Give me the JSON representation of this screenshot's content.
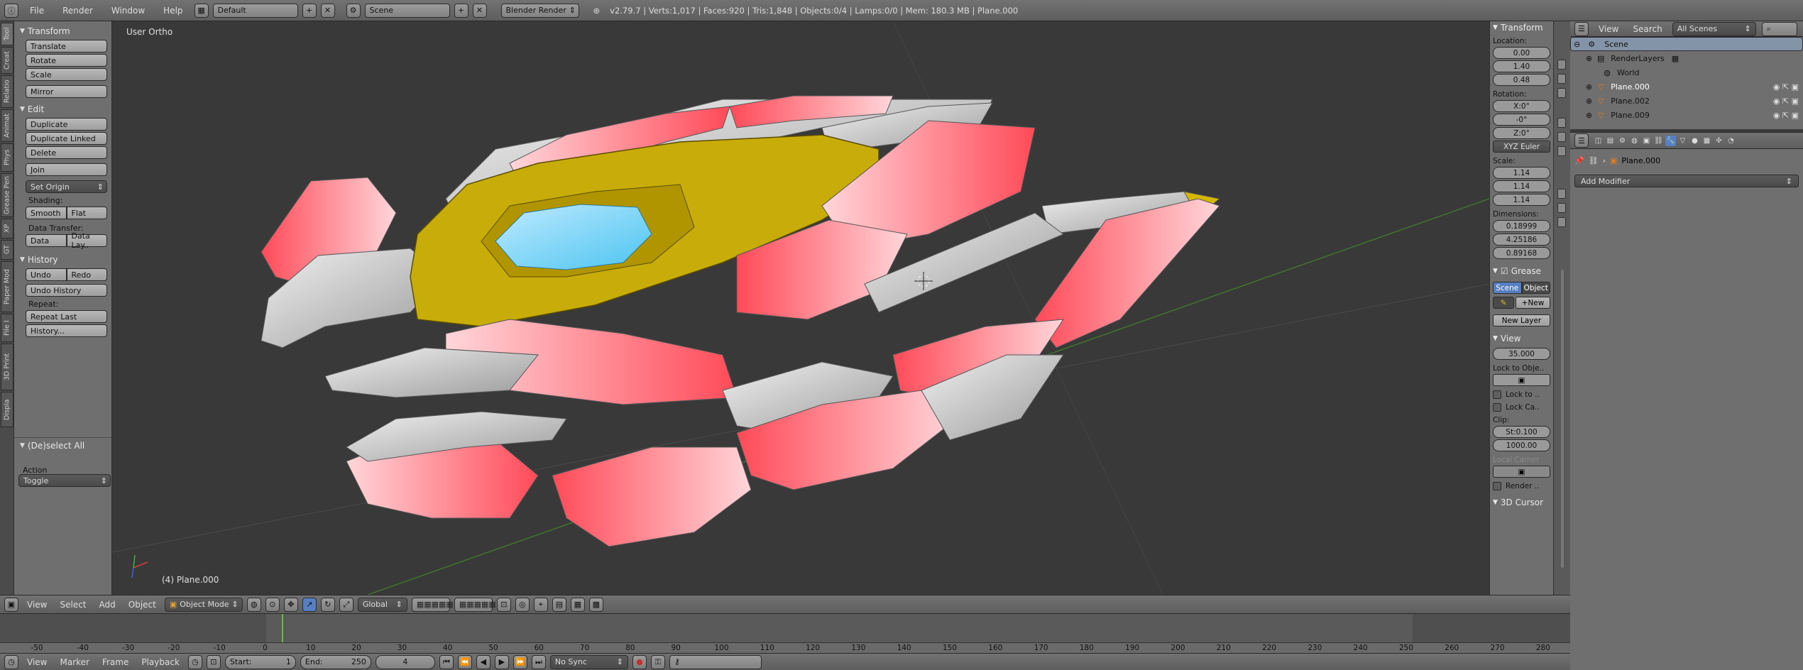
{
  "topbar": {
    "menus": [
      "File",
      "Render",
      "Window",
      "Help"
    ],
    "layout": "Default",
    "scene": "Scene",
    "engine": "Blender Render",
    "stats": "v2.79.7 | Verts:1,017 | Faces:920 | Tris:1,848 | Objects:0/4 | Lamps:0/0 | Mem: 180.3 MB | Plane.000"
  },
  "tool_tabs": [
    "Tool",
    "Creat",
    "Relatio",
    "Animat",
    "Phys",
    "Grease Pen",
    "XP",
    "GT",
    "Paper Mod",
    "File I",
    "3D Print",
    "Displa"
  ],
  "shelf": {
    "transform_title": "Transform",
    "translate": "Translate",
    "rotate": "Rotate",
    "scale": "Scale",
    "mirror": "Mirror",
    "edit_title": "Edit",
    "duplicate": "Duplicate",
    "duplicate_linked": "Duplicate Linked",
    "delete": "Delete",
    "join": "Join",
    "set_origin": "Set Origin",
    "shading_label": "Shading:",
    "smooth": "Smooth",
    "flat": "Flat",
    "data_transfer_label": "Data Transfer:",
    "data": "Data",
    "data_lay": "Data Lay..",
    "history_title": "History",
    "undo": "Undo",
    "redo": "Redo",
    "undo_history": "Undo History",
    "repeat_label": "Repeat:",
    "repeat_last": "Repeat Last",
    "history_more": "History...",
    "operator_title": "(De)select All",
    "action_label": "Action",
    "action_value": "Toggle"
  },
  "viewport": {
    "view_label": "User Ortho",
    "object_label": "(4) Plane.000"
  },
  "npanel": {
    "transform": "Transform",
    "location_label": "Location:",
    "location": [
      "0.00",
      "1.40",
      "0.48"
    ],
    "rotation_label": "Rotation:",
    "rotation": [
      "X:0°",
      "-0°",
      "Z:0°"
    ],
    "rotation_mode": "XYZ Euler",
    "scale_label": "Scale:",
    "scale": [
      "1.14",
      "1.14",
      "1.14"
    ],
    "dimensions_label": "Dimensions:",
    "dimensions": [
      "0.18999",
      "4.25186",
      "0.89168"
    ],
    "grease": "Grease",
    "scene_btn": "Scene",
    "object_btn": "Object",
    "new_btn": "New",
    "new_layer": "New Layer",
    "view": "View",
    "lens": "35.000",
    "lock_to_object": "Lock to Obje..",
    "lock_to": "Lock to ..",
    "lock_ca": "Lock Ca..",
    "clip_label": "Clip:",
    "clip_start": "St:0.100",
    "clip_end": "1000.00",
    "local_camera": "Local Camer",
    "render": "Render ..",
    "cursor": "3D Cursor"
  },
  "outliner": {
    "view": "View",
    "search": "Search",
    "scenes": "All Scenes",
    "rows": [
      {
        "label": "Scene",
        "indent": 0
      },
      {
        "label": "RenderLayers",
        "indent": 1
      },
      {
        "label": "World",
        "indent": 2
      },
      {
        "label": "Plane.000",
        "indent": 1
      },
      {
        "label": "Plane.002",
        "indent": 1
      },
      {
        "label": "Plane.009",
        "indent": 1
      }
    ]
  },
  "properties": {
    "object_name": "Plane.000",
    "add_modifier": "Add Modifier"
  },
  "viewport_header": {
    "view": "View",
    "select": "Select",
    "add": "Add",
    "object": "Object",
    "mode": "Object Mode",
    "orientation": "Global"
  },
  "timeline": {
    "ticks": [
      "-50",
      "-40",
      "-30",
      "-20",
      "-10",
      "0",
      "10",
      "20",
      "30",
      "40",
      "50",
      "60",
      "70",
      "80",
      "90",
      "100",
      "110",
      "120",
      "130",
      "140",
      "150",
      "160",
      "170",
      "180",
      "190",
      "200",
      "210",
      "220",
      "230",
      "240",
      "250",
      "260",
      "270",
      "280"
    ],
    "current_frame": 4
  },
  "timeline_header": {
    "view": "View",
    "marker": "Marker",
    "frame": "Frame",
    "playback": "Playback",
    "start": "Start:",
    "start_val": "1",
    "end": "End:",
    "end_val": "250",
    "current": "4",
    "sync": "No Sync"
  }
}
